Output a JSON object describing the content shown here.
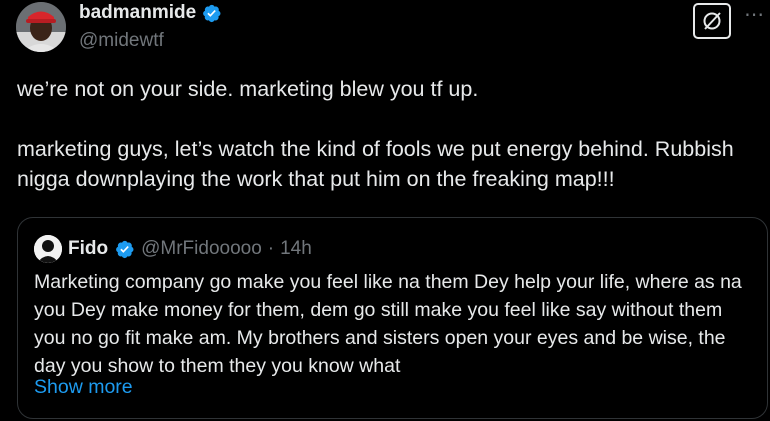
{
  "author": {
    "display_name": "badmanmide",
    "handle": "@midewtf",
    "verified": true
  },
  "tweet": {
    "line1": "we’re not on your side. marketing blew you tf up.",
    "line2": "marketing guys, let’s watch the kind of fools we put energy behind. Rubbish nigga downplaying the work that put him on the freaking map!!!"
  },
  "quote": {
    "display_name": "Fido",
    "handle": "@MrFidooooo",
    "separator": "·",
    "time": "14h",
    "verified": true,
    "text": "Marketing company go make you feel like na them Dey help your life, where as na you Dey make money for them, dem go still make you feel like say without them you no go fit make am. My brothers and sisters open your eyes and be wise, the day you show to them they you know what",
    "show_more": "Show more"
  },
  "icons": {
    "grok": "grok-icon",
    "more": "more-icon",
    "verified": "verified-badge-icon"
  },
  "colors": {
    "background": "#000000",
    "text": "#e7e9ea",
    "muted": "#71767b",
    "accent": "#1d9bf0",
    "border": "#2f3336"
  }
}
